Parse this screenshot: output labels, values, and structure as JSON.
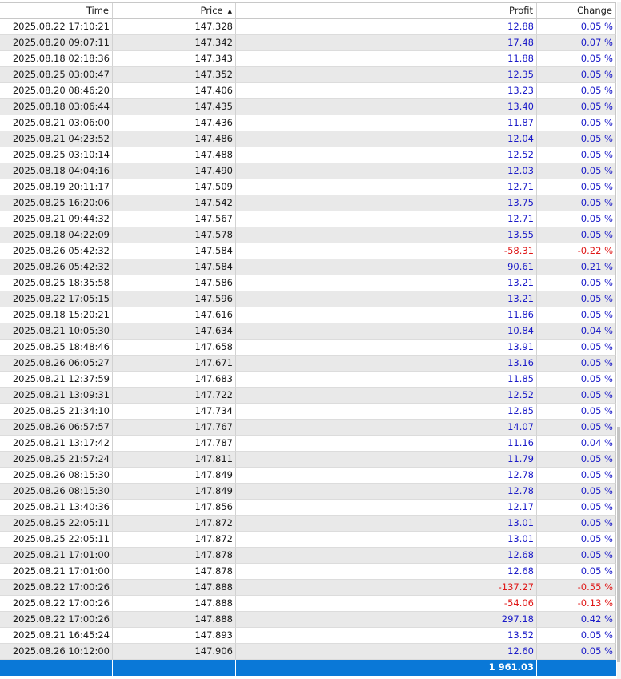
{
  "columns": [
    {
      "label": "Time"
    },
    {
      "label": "Price",
      "sort": "ascending"
    },
    {
      "label": "Profit"
    },
    {
      "label": "Change"
    }
  ],
  "rows": [
    {
      "time": "2025.08.22 17:10:21",
      "price": "147.328",
      "profit": "12.88",
      "change": "0.05 %"
    },
    {
      "time": "2025.08.20 09:07:11",
      "price": "147.342",
      "profit": "17.48",
      "change": "0.07 %"
    },
    {
      "time": "2025.08.18 02:18:36",
      "price": "147.343",
      "profit": "11.88",
      "change": "0.05 %"
    },
    {
      "time": "2025.08.25 03:00:47",
      "price": "147.352",
      "profit": "12.35",
      "change": "0.05 %"
    },
    {
      "time": "2025.08.20 08:46:20",
      "price": "147.406",
      "profit": "13.23",
      "change": "0.05 %"
    },
    {
      "time": "2025.08.18 03:06:44",
      "price": "147.435",
      "profit": "13.40",
      "change": "0.05 %"
    },
    {
      "time": "2025.08.21 03:06:00",
      "price": "147.436",
      "profit": "11.87",
      "change": "0.05 %"
    },
    {
      "time": "2025.08.21 04:23:52",
      "price": "147.486",
      "profit": "12.04",
      "change": "0.05 %"
    },
    {
      "time": "2025.08.25 03:10:14",
      "price": "147.488",
      "profit": "12.52",
      "change": "0.05 %"
    },
    {
      "time": "2025.08.18 04:04:16",
      "price": "147.490",
      "profit": "12.03",
      "change": "0.05 %"
    },
    {
      "time": "2025.08.19 20:11:17",
      "price": "147.509",
      "profit": "12.71",
      "change": "0.05 %"
    },
    {
      "time": "2025.08.25 16:20:06",
      "price": "147.542",
      "profit": "13.75",
      "change": "0.05 %"
    },
    {
      "time": "2025.08.21 09:44:32",
      "price": "147.567",
      "profit": "12.71",
      "change": "0.05 %"
    },
    {
      "time": "2025.08.18 04:22:09",
      "price": "147.578",
      "profit": "13.55",
      "change": "0.05 %"
    },
    {
      "time": "2025.08.26 05:42:32",
      "price": "147.584",
      "profit": "-58.31",
      "change": "-0.22 %"
    },
    {
      "time": "2025.08.26 05:42:32",
      "price": "147.584",
      "profit": "90.61",
      "change": "0.21 %"
    },
    {
      "time": "2025.08.25 18:35:58",
      "price": "147.586",
      "profit": "13.21",
      "change": "0.05 %"
    },
    {
      "time": "2025.08.22 17:05:15",
      "price": "147.596",
      "profit": "13.21",
      "change": "0.05 %"
    },
    {
      "time": "2025.08.18 15:20:21",
      "price": "147.616",
      "profit": "11.86",
      "change": "0.05 %"
    },
    {
      "time": "2025.08.21 10:05:30",
      "price": "147.634",
      "profit": "10.84",
      "change": "0.04 %"
    },
    {
      "time": "2025.08.25 18:48:46",
      "price": "147.658",
      "profit": "13.91",
      "change": "0.05 %"
    },
    {
      "time": "2025.08.26 06:05:27",
      "price": "147.671",
      "profit": "13.16",
      "change": "0.05 %"
    },
    {
      "time": "2025.08.21 12:37:59",
      "price": "147.683",
      "profit": "11.85",
      "change": "0.05 %"
    },
    {
      "time": "2025.08.21 13:09:31",
      "price": "147.722",
      "profit": "12.52",
      "change": "0.05 %"
    },
    {
      "time": "2025.08.25 21:34:10",
      "price": "147.734",
      "profit": "12.85",
      "change": "0.05 %"
    },
    {
      "time": "2025.08.26 06:57:57",
      "price": "147.767",
      "profit": "14.07",
      "change": "0.05 %"
    },
    {
      "time": "2025.08.21 13:17:42",
      "price": "147.787",
      "profit": "11.16",
      "change": "0.04 %"
    },
    {
      "time": "2025.08.25 21:57:24",
      "price": "147.811",
      "profit": "11.79",
      "change": "0.05 %"
    },
    {
      "time": "2025.08.26 08:15:30",
      "price": "147.849",
      "profit": "12.78",
      "change": "0.05 %"
    },
    {
      "time": "2025.08.26 08:15:30",
      "price": "147.849",
      "profit": "12.78",
      "change": "0.05 %"
    },
    {
      "time": "2025.08.21 13:40:36",
      "price": "147.856",
      "profit": "12.17",
      "change": "0.05 %"
    },
    {
      "time": "2025.08.25 22:05:11",
      "price": "147.872",
      "profit": "13.01",
      "change": "0.05 %"
    },
    {
      "time": "2025.08.25 22:05:11",
      "price": "147.872",
      "profit": "13.01",
      "change": "0.05 %"
    },
    {
      "time": "2025.08.21 17:01:00",
      "price": "147.878",
      "profit": "12.68",
      "change": "0.05 %"
    },
    {
      "time": "2025.08.21 17:01:00",
      "price": "147.878",
      "profit": "12.68",
      "change": "0.05 %"
    },
    {
      "time": "2025.08.22 17:00:26",
      "price": "147.888",
      "profit": "-137.27",
      "change": "-0.55 %"
    },
    {
      "time": "2025.08.22 17:00:26",
      "price": "147.888",
      "profit": "-54.06",
      "change": "-0.13 %"
    },
    {
      "time": "2025.08.22 17:00:26",
      "price": "147.888",
      "profit": "297.18",
      "change": "0.42 %"
    },
    {
      "time": "2025.08.21 16:45:24",
      "price": "147.893",
      "profit": "13.52",
      "change": "0.05 %"
    },
    {
      "time": "2025.08.26 10:12:00",
      "price": "147.906",
      "profit": "12.60",
      "change": "0.05 %"
    }
  ],
  "footer": {
    "time": "",
    "price": "",
    "profit": "1 961.03",
    "change": ""
  },
  "colors": {
    "positive": "#1a1ac8",
    "negative": "#e01818",
    "footer_bg": "#0a78d7",
    "alt_row": "#e9e9e9"
  },
  "icons": {
    "sort_ascending": "triangle-up-icon"
  }
}
